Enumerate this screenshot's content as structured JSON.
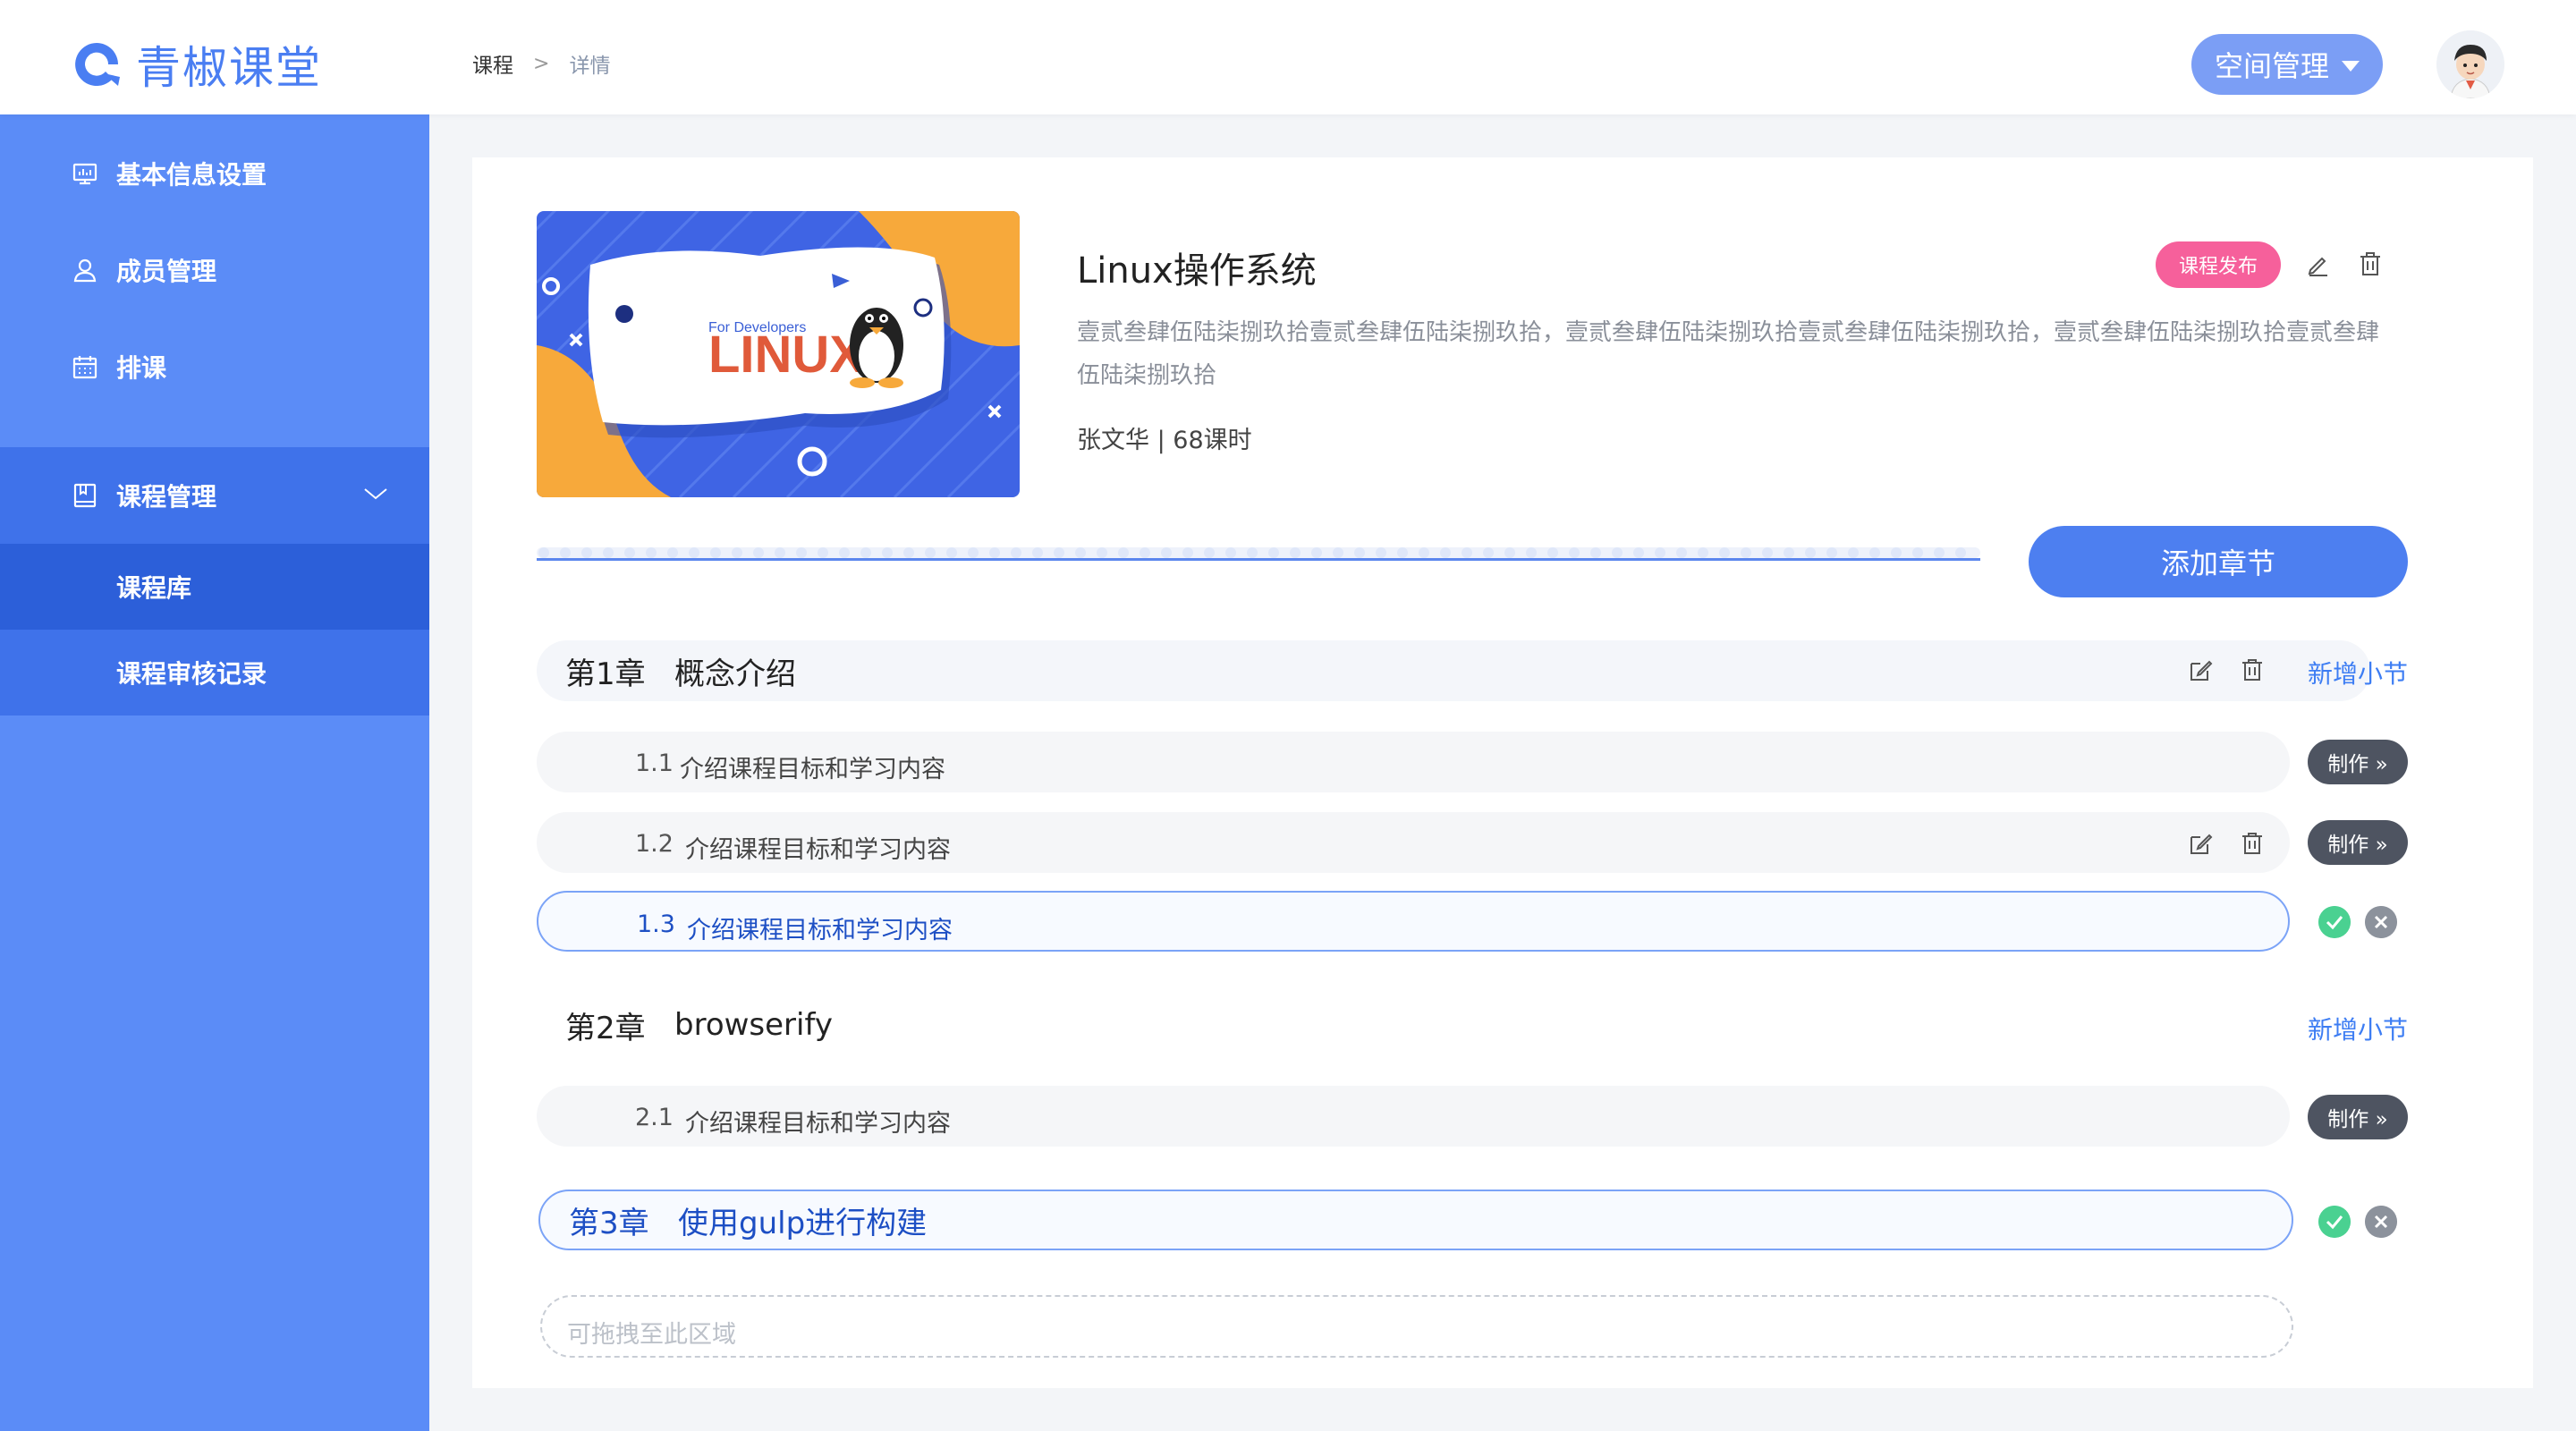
{
  "header": {
    "logo_text": "青椒课堂",
    "breadcrumb": [
      "课程",
      "详情"
    ],
    "breadcrumb_sep": ">",
    "space_button_label": "空间管理"
  },
  "sidebar": {
    "items": [
      {
        "label": "基本信息设置",
        "icon": "monitor-icon"
      },
      {
        "label": "成员管理",
        "icon": "user-icon"
      },
      {
        "label": "排课",
        "icon": "calendar-icon"
      },
      {
        "label": "课程管理",
        "icon": "book-icon",
        "expanded": true
      }
    ],
    "sub_items": [
      {
        "label": "课程库",
        "selected": true
      },
      {
        "label": "课程审核记录",
        "selected": false
      }
    ]
  },
  "course": {
    "title": "Linux操作系统",
    "publish_label": "课程发布",
    "description": "壹贰叁肆伍陆柒捌玖拾壹贰叁肆伍陆柒捌玖拾，壹贰叁肆伍陆柒捌玖拾壹贰叁肆伍陆柒捌玖拾，壹贰叁肆伍陆柒捌玖拾壹贰叁肆伍陆柒捌玖拾",
    "meta": "张文华 | 68课时",
    "cover_text": "LINUX",
    "cover_subtext": "For Developers"
  },
  "add_chapter_label": "添加章节",
  "chapters": [
    {
      "num": "第1章",
      "title": "概念介绍",
      "add_section_label": "新增小节"
    },
    {
      "num": "第2章",
      "title": "browserify",
      "add_section_label": "新增小节"
    },
    {
      "num": "第3章",
      "title": "使用gulp进行构建",
      "editing": true
    }
  ],
  "sections": [
    {
      "num": "1.1",
      "title": "介绍课程目标和学习内容",
      "make_label": "制作 »"
    },
    {
      "num": "1.2",
      "title": "介绍课程目标和学习内容",
      "make_label": "制作 »"
    },
    {
      "num": "1.3",
      "title": "介绍课程目标和学习内容",
      "editing": true
    },
    {
      "num": "2.1",
      "title": "介绍课程目标和学习内容",
      "make_label": "制作 »"
    }
  ],
  "drop_zone_text": "可拖拽至此区域",
  "colors": {
    "primary": "#4d7ff0",
    "sidebar": "#5b8cf7",
    "publish": "#f6609b",
    "confirm": "#4ad191",
    "cancel": "#8c929c"
  }
}
